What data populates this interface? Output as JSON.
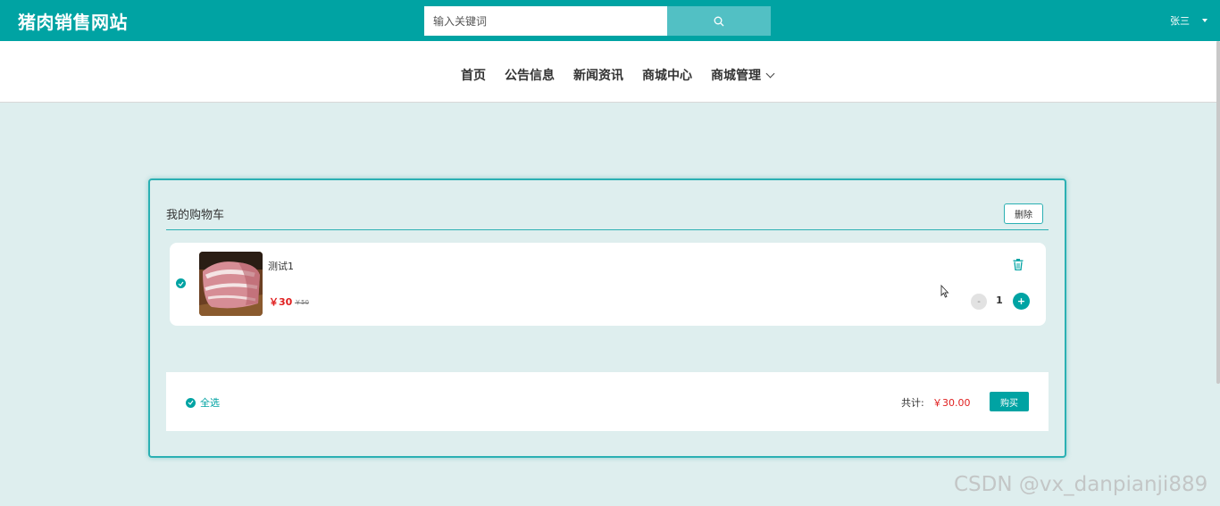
{
  "header": {
    "logo": "猪肉销售网站",
    "search_placeholder": "输入关键词",
    "user_name": "张三"
  },
  "nav": {
    "items": [
      "首页",
      "公告信息",
      "新闻资讯",
      "商城中心",
      "商城管理"
    ]
  },
  "cart": {
    "title": "我的购物车",
    "delete_label": "删除",
    "items": [
      {
        "name": "测试1",
        "price": "￥30",
        "original_price": "￥50",
        "quantity": "1",
        "selected": true
      }
    ],
    "select_all_label": "全选",
    "total_label": "共计:",
    "total_value": "￥30.00",
    "buy_label": "购买"
  },
  "watermark": "CSDN @vx_danpianji889",
  "colors": {
    "primary": "#00a3a3",
    "search_button": "#52c0c4",
    "page_background": "#deeeee",
    "price_red": "#e02020"
  }
}
